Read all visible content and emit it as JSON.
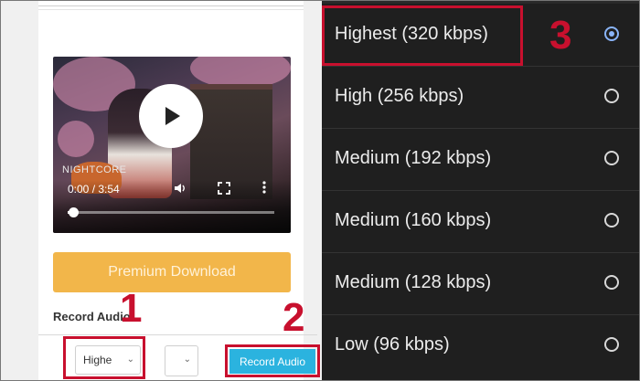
{
  "video": {
    "watermark": "NIGHTCORE",
    "time": "0:00 / 3:54",
    "progress_fraction": 0.01
  },
  "buttons": {
    "premium_download": "Premium Download",
    "record_audio": "Record Audio"
  },
  "record_section": {
    "heading": "Record Audio",
    "quality_select_value": "Highe",
    "chevron": "⌄"
  },
  "annotations": {
    "step1": "1",
    "step2": "2",
    "step3": "3",
    "highlight_color": "#c8102e"
  },
  "bitrate_menu": {
    "items": [
      {
        "label": "Highest (320 kbps)",
        "selected": true
      },
      {
        "label": "High (256 kbps)",
        "selected": false
      },
      {
        "label": "Medium (192 kbps)",
        "selected": false
      },
      {
        "label": "Medium (160 kbps)",
        "selected": false
      },
      {
        "label": "Medium (128 kbps)",
        "selected": false
      },
      {
        "label": "Low (96 kbps)",
        "selected": false
      }
    ],
    "accent_color": "#8ab4f8"
  },
  "icons": [
    "play-icon",
    "volume-icon",
    "fullscreen-icon",
    "more-vert-icon",
    "chevron-down-icon",
    "radio-icon"
  ]
}
